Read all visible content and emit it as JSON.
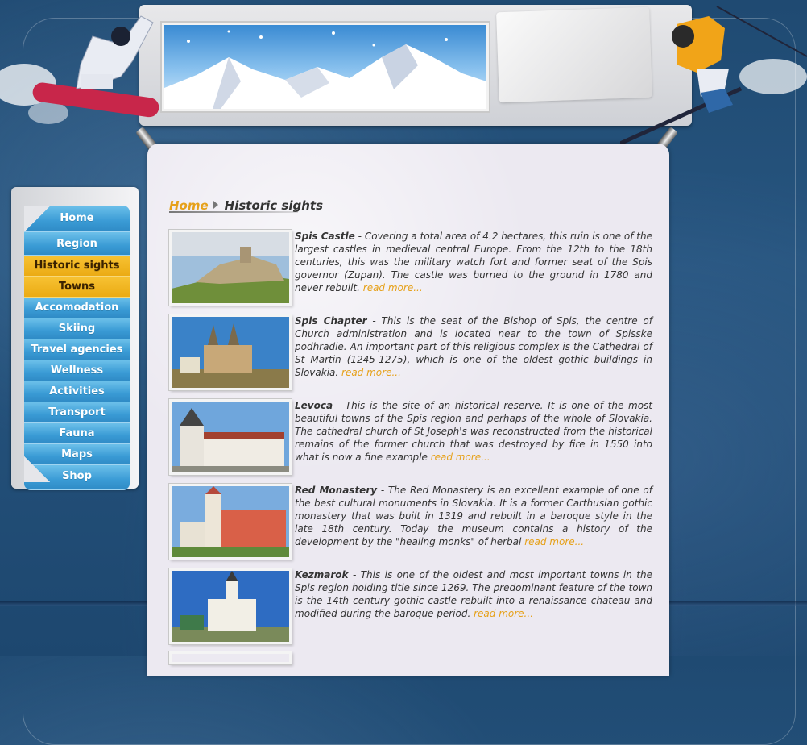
{
  "nav": {
    "items": [
      {
        "label": "Home"
      },
      {
        "label": "Region"
      },
      {
        "label": "Historic sights"
      },
      {
        "label": "Towns"
      },
      {
        "label": "Accomodation"
      },
      {
        "label": "Skiing"
      },
      {
        "label": "Travel agencies"
      },
      {
        "label": "Wellness"
      },
      {
        "label": "Activities"
      },
      {
        "label": "Transport"
      },
      {
        "label": "Fauna"
      },
      {
        "label": "Maps"
      },
      {
        "label": "Shop"
      }
    ],
    "active": [
      "Historic sights",
      "Towns"
    ]
  },
  "breadcrumb": {
    "home": "Home",
    "current": "Historic sights"
  },
  "items": [
    {
      "title": "Spis Castle",
      "text": " - Covering a total area of 4.2 hectares, this ruin is one of the largest castles in medieval central Europe. From the 12th to the 18th centuries, this was the military watch fort and former seat of the Spis governor (Zupan). The castle was burned to the ground in 1780 and never rebuilt. ",
      "more": "read more..."
    },
    {
      "title": "Spis Chapter",
      "text": " - This is the seat of the Bishop of Spis, the centre of Church administration and is located near to the town of Spisske podhradie. An important part of this religious complex is the Cathedral of St Martin (1245-1275), which is one of the oldest gothic buildings in Slovakia. ",
      "more": "read more..."
    },
    {
      "title": "Levoca",
      "text": " - This is the site of an historical reserve. It is one of the most beautiful towns of the Spis region and perhaps of the whole of Slovakia. The cathedral church of St Joseph's was reconstructed from the historical remains of the former church that was destroyed by fire in 1550 into what is now a fine example ",
      "more": "read more..."
    },
    {
      "title": "Red Monastery",
      "text": " - The Red Monastery is an excellent example of one of the best cultural monuments in Slovakia. It is a former Carthusian gothic monastery that was built in 1319 and rebuilt in a baroque style in the late 18th century. Today the museum contains a history of the development by the \"healing monks\" of herbal ",
      "more": "read more..."
    },
    {
      "title": "Kezmarok",
      "text": " - This is one of the oldest and most important towns in the Spis region holding title since 1269. The predominant feature of the town is the 14th century gothic castle rebuilt into a renaissance chateau and modified during the baroque period. ",
      "more": "read more..."
    }
  ],
  "colors": {
    "accent": "#e6a11a",
    "nav_blue": "#3a9bd5",
    "nav_active": "#ebab14",
    "background": "#1f4a72"
  }
}
